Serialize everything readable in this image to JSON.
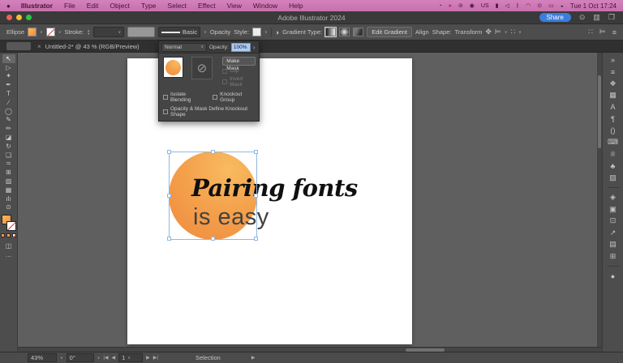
{
  "colors": {
    "menubar_pink": "#cf79b8",
    "share_blue": "#3b7ddd",
    "selection_blue": "#8fb9e3",
    "circle_gradient_from": "#f9bb60",
    "circle_gradient_to": "#ee8a3e"
  },
  "menubar": {
    "apple_icon": "●",
    "items": [
      {
        "label": "Illustrator",
        "state": "app"
      },
      {
        "label": "File"
      },
      {
        "label": "Edit"
      },
      {
        "label": "Object"
      },
      {
        "label": "Type"
      },
      {
        "label": "Select"
      },
      {
        "label": "Effect"
      },
      {
        "label": "View"
      },
      {
        "label": "Window"
      },
      {
        "label": "Help"
      }
    ],
    "status_icons": [
      {
        "name": "screen-time-icon",
        "glyph": "◔"
      },
      {
        "name": "app-status-icon",
        "glyph": "●",
        "state": "red"
      },
      {
        "name": "do-not-disturb-icon",
        "glyph": "⊘"
      },
      {
        "name": "record-icon",
        "glyph": "◉"
      },
      {
        "name": "input-source-us-icon",
        "glyph": "US"
      },
      {
        "name": "battery-icon",
        "glyph": "▮"
      },
      {
        "name": "volume-icon",
        "glyph": "◁"
      },
      {
        "name": "bluetooth-icon",
        "glyph": "ᛒ"
      },
      {
        "name": "wifi-icon",
        "glyph": "◠"
      },
      {
        "name": "spotlight-icon",
        "glyph": "⊙"
      },
      {
        "name": "display-icon",
        "glyph": "▭"
      },
      {
        "name": "control-center-icon",
        "glyph": "◒"
      }
    ],
    "clock": "Tue 1 Oct 17:24"
  },
  "titlebar": {
    "title": "Adobe Illustrator 2024",
    "share_label": "Share",
    "search_icon": "⊙",
    "workspace_icon": "▥",
    "window_icon": "❐"
  },
  "control_bar": {
    "context_label": "Ellipse",
    "stroke_label": "Stroke:",
    "style_name": "Basic",
    "opacity_label": "Opacity",
    "style_label": "Style:",
    "gradient_type_label": "Gradient Type:",
    "edit_gradient_label": "Edit Gradient",
    "align_label": "Align",
    "shape_label": "Shape:",
    "transform_label": "Transform",
    "icons": {
      "recolor": "◑",
      "free_transform": "✥",
      "align_objects": "⊨",
      "distribute": "∷",
      "workspace_grid": "∷",
      "align_artboard": "⊨",
      "menu": "≡",
      "chevron": "∨"
    }
  },
  "document_tab": {
    "close_icon": "×",
    "title": "Untitled-2* @ 43 % (RGB/Preview)"
  },
  "transparency_panel": {
    "blend_mode": "Normal",
    "chevron": "∨",
    "opacity_label": "Opacity:",
    "opacity_value": "100%",
    "expand_icon": "›",
    "no_mask_icon": "⊘",
    "make_mask_label": "Make Mask",
    "clip_label": "Clip",
    "invert_mask_label": "Invert Mask",
    "isolate_blending_label": "Isolate Blending",
    "knockout_group_label": "Knockout Group",
    "define_knockout_label": "Opacity & Mask Define Knockout Shape"
  },
  "toolbar": {
    "tools": [
      {
        "name": "selection-tool",
        "glyph": "↖",
        "state": "active"
      },
      {
        "name": "direct-selection-tool",
        "glyph": "▷"
      },
      {
        "name": "magic-wand-tool",
        "glyph": "✦"
      },
      {
        "name": "pen-tool",
        "glyph": "✒"
      },
      {
        "name": "type-tool",
        "glyph": "T"
      },
      {
        "name": "line-tool",
        "glyph": "∕"
      },
      {
        "name": "ellipse-tool",
        "glyph": "◯"
      },
      {
        "name": "paintbrush-tool",
        "glyph": "✎"
      },
      {
        "name": "pencil-tool",
        "glyph": "✏"
      },
      {
        "name": "eraser-tool",
        "glyph": "◪"
      },
      {
        "name": "rotate-tool",
        "glyph": "↻"
      },
      {
        "name": "scale-tool",
        "glyph": "❏"
      },
      {
        "name": "width-tool",
        "glyph": "≍"
      },
      {
        "name": "shape-builder-tool",
        "glyph": "⊞"
      },
      {
        "name": "gradient-tool",
        "glyph": "▨"
      },
      {
        "name": "mesh-tool",
        "glyph": "▦"
      },
      {
        "name": "graph-tool",
        "glyph": "ılı"
      },
      {
        "name": "zoom-tool",
        "glyph": "⊙"
      }
    ],
    "screen_mode_icon": "◫",
    "ellipsis_icon": "…"
  },
  "right_panel": {
    "icons": [
      {
        "name": "collapse-panels-icon",
        "glyph": "»"
      },
      {
        "name": "properties-icon",
        "glyph": "≡"
      },
      {
        "name": "libraries-icon",
        "glyph": "❖"
      },
      {
        "name": "image-trace-icon",
        "glyph": "▦"
      },
      {
        "name": "character-icon",
        "glyph": "A"
      },
      {
        "name": "paragraph-icon",
        "glyph": "¶"
      },
      {
        "name": "glyphs-icon",
        "glyph": "()"
      },
      {
        "name": "keyboard-shortcuts-icon",
        "glyph": "⌨"
      },
      {
        "name": "graphic-styles-icon",
        "glyph": "♕"
      },
      {
        "name": "symbols-icon",
        "glyph": "♣"
      },
      {
        "name": "swatches-icon",
        "glyph": "▧"
      },
      {
        "name": "panel-divider",
        "glyph": "",
        "state": "divider"
      },
      {
        "name": "layers-icon",
        "glyph": "◈"
      },
      {
        "name": "artboards-icon",
        "glyph": "▣"
      },
      {
        "name": "asset-export-icon",
        "glyph": "⊡"
      },
      {
        "name": "export-icon",
        "glyph": "↗"
      },
      {
        "name": "pattern-icon",
        "glyph": "▤"
      },
      {
        "name": "transform-icon",
        "glyph": "⊞"
      },
      {
        "name": "panel-divider",
        "glyph": "",
        "state": "divider"
      },
      {
        "name": "color-icon",
        "glyph": "●"
      }
    ]
  },
  "canvas": {
    "heading": "Pairing fonts",
    "subheading": "is easy"
  },
  "statusbar": {
    "zoom_value": "43%",
    "rotation_value": "0°",
    "artboard_value": "1",
    "status_label": "Selection",
    "chevron": "∨",
    "nav": {
      "first": "|◀",
      "prev": "◀",
      "next": "▶",
      "last": "▶|"
    },
    "play_icon": "▶"
  }
}
